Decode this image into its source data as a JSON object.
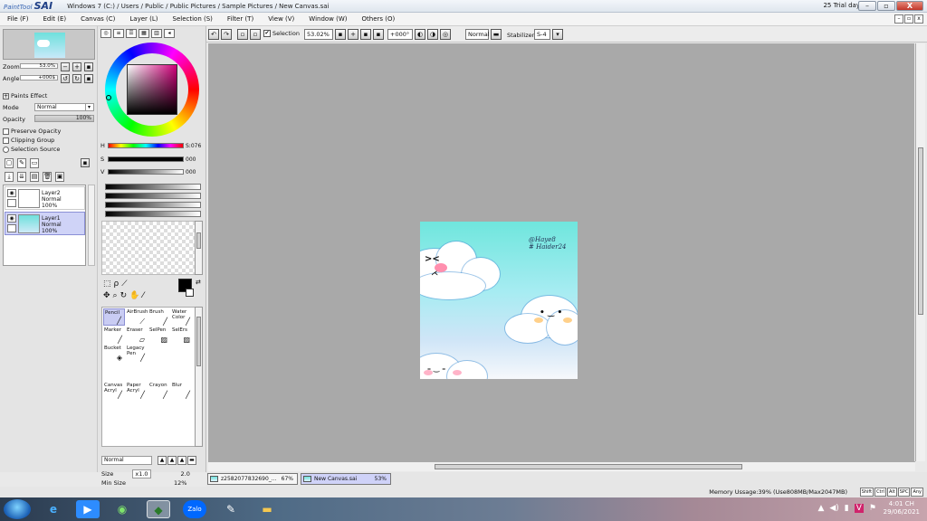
{
  "window": {
    "logo_small": "PaintTool",
    "logo_big": "SAI",
    "title": "Windows 7 (C:) / Users / Public / Public Pictures / Sample Pictures / New Canvas.sai",
    "trial": "25 Trial day"
  },
  "menu": [
    "File (F)",
    "Edit (E)",
    "Canvas (C)",
    "Layer (L)",
    "Selection (S)",
    "Filter (T)",
    "View (V)",
    "Window (W)",
    "Others (O)"
  ],
  "navigator": {
    "zoom_label": "Zoom",
    "zoom_value": "53.0%",
    "angle_label": "Angle",
    "angle_value": "+000$"
  },
  "layer_props": {
    "paints_effect": "Paints Effect",
    "mode_label": "Mode",
    "mode_value": "Normal",
    "opacity_label": "Opacity",
    "opacity_value": "100%",
    "preserve_opacity": "Preserve Opacity",
    "clipping_group": "Clipping Group",
    "selection_source": "Selection Source"
  },
  "layers": [
    {
      "name": "Layer2",
      "mode": "Normal",
      "opacity": "100%"
    },
    {
      "name": "Layer1",
      "mode": "Normal",
      "opacity": "100%"
    }
  ],
  "color": {
    "h_label": "H",
    "h_value": "S:076",
    "s_label": "S",
    "s_value": "000",
    "v_label": "V",
    "v_value": "000"
  },
  "tools": [
    {
      "label": "Pencil",
      "icon": "pencil-icon"
    },
    {
      "label": "AirBrush",
      "icon": "airbrush-icon"
    },
    {
      "label": "Brush",
      "icon": "brush-icon"
    },
    {
      "label": "Water Color",
      "icon": "watercolor-icon"
    },
    {
      "label": "Marker",
      "icon": "marker-icon"
    },
    {
      "label": "Eraser",
      "icon": "eraser-icon"
    },
    {
      "label": "SelPen",
      "icon": "selpen-icon"
    },
    {
      "label": "SelErs",
      "icon": "selers-icon"
    },
    {
      "label": "Bucket",
      "icon": "bucket-icon"
    },
    {
      "label": "Legacy Pen",
      "icon": "legacy-pen-icon"
    },
    {
      "label": "Canvas Acryl",
      "icon": "acryl-icon"
    },
    {
      "label": "Paper Acryl",
      "icon": "paper-acryl-icon"
    },
    {
      "label": "Crayon",
      "icon": "crayon-icon"
    },
    {
      "label": "Blur",
      "icon": "blur-icon"
    }
  ],
  "brush": {
    "blend_mode": "Normal",
    "size_label": "Size",
    "size_mult": "x1.0",
    "size_value": "2.0",
    "min_size_label": "Min Size",
    "min_size_value": "12%"
  },
  "toolbar": {
    "selection_label": "Selection",
    "zoom_value": "53.02%",
    "angle_value": "+000°",
    "mode_value": "Normal",
    "stabilizer_label": "Stabilizer",
    "stabilizer_value": "S-4"
  },
  "artwork": {
    "signature_line1": "@Haye8",
    "signature_line2": "# Haider24"
  },
  "doc_tabs": [
    {
      "name": "z2582077832690_...",
      "zoom": "67%"
    },
    {
      "name": "New Canvas.sai",
      "zoom": "53%"
    }
  ],
  "status": {
    "memory": "Memory Ussage:39% (Use808MB/Max2047MB)",
    "hints": [
      "Shift",
      "Ctrl",
      "Alt",
      "SPC",
      "Any"
    ]
  },
  "taskbar": {
    "time": "4:01 CH",
    "date": "29/06/2021",
    "zalo_label": "Zalo"
  }
}
